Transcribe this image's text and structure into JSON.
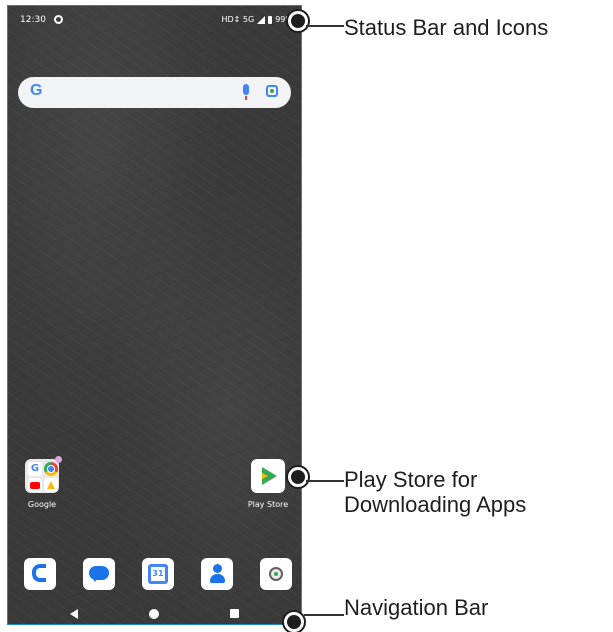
{
  "status_bar": {
    "time": "12:30",
    "right_text": "HD↕ 5G",
    "battery": "99%",
    "icons": [
      "notification-icon",
      "signal-icon",
      "battery-icon"
    ]
  },
  "search": {
    "logo": "G",
    "icons": [
      "mic-icon",
      "lens-icon"
    ]
  },
  "home_apps": [
    {
      "label": "Google",
      "type": "folder"
    },
    {
      "label": "Play Store",
      "type": "app"
    }
  ],
  "dock": [
    {
      "name": "phone-icon"
    },
    {
      "name": "messages-icon"
    },
    {
      "name": "calendar-icon",
      "text": "31"
    },
    {
      "name": "contacts-icon"
    },
    {
      "name": "camera-icon"
    }
  ],
  "nav": [
    "back-button",
    "home-button",
    "recents-button"
  ],
  "callouts": {
    "status": "Status Bar and Icons",
    "play_line1": "Play Store for",
    "play_line2": "Downloading Apps",
    "nav": "Navigation Bar"
  },
  "colors": {
    "frame_border": "#1b88c8",
    "google_blue": "#4285f4",
    "play_green": "#34a853"
  }
}
